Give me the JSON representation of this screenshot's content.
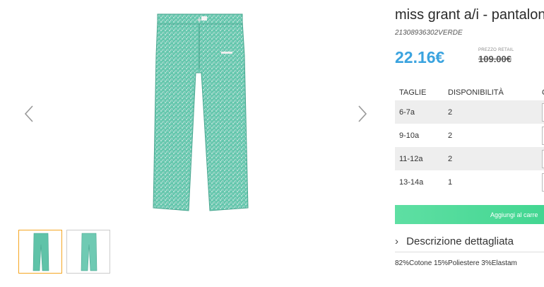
{
  "product": {
    "title": "miss grant a/i - pantalon",
    "sku": "21308936302VERDE",
    "price": "22.16€",
    "retail_label": "PREZZO RETAIL",
    "retail_price": "109.00€",
    "image_color": "#5fc3a8"
  },
  "gallery": {
    "prev_icon": "chevron-left-icon",
    "next_icon": "chevron-right-icon",
    "thumbnail_count": 2,
    "active_thumbnail": 1
  },
  "table": {
    "headers": [
      "TAGLIE",
      "DISPONIBILITÀ",
      "Q"
    ],
    "rows": [
      {
        "size": "6-7a",
        "availability": "2"
      },
      {
        "size": "9-10a",
        "availability": "2"
      },
      {
        "size": "11-12a",
        "availability": "2"
      },
      {
        "size": "13-14a",
        "availability": "1"
      }
    ]
  },
  "cart": {
    "button_label": "Aggiungi al carre"
  },
  "description": {
    "toggle_label": "Descrizione dettagliata",
    "composition": "82%Cotone 15%Poliestere 3%Elastam"
  },
  "colors": {
    "accent_price": "#3aa3df",
    "cart_button": "#4fdc99",
    "active_thumb_border": "#f5a623"
  }
}
